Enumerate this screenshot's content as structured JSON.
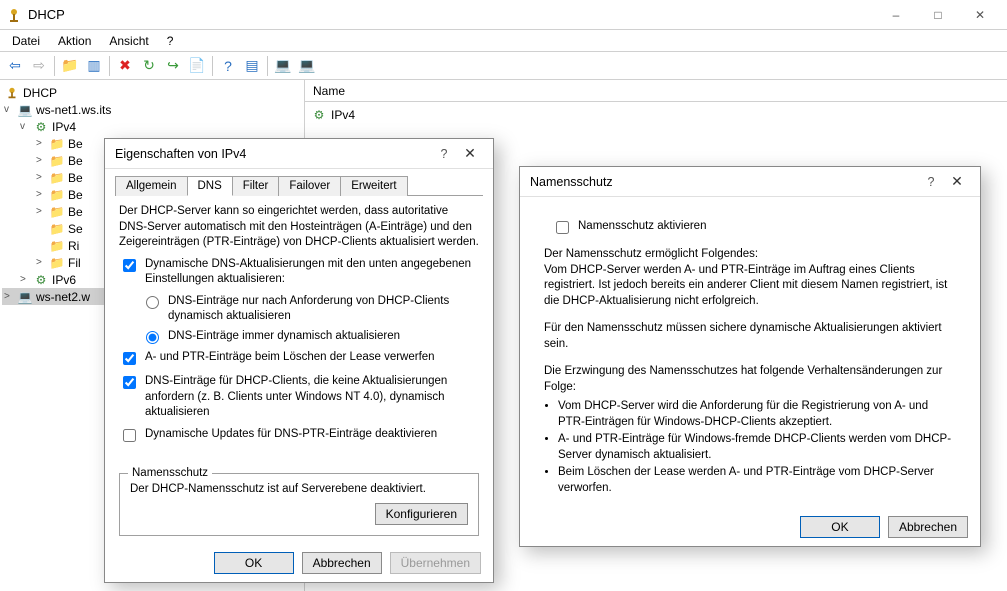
{
  "window": {
    "title": "DHCP"
  },
  "menu": {
    "file": "Datei",
    "action": "Aktion",
    "view": "Ansicht",
    "help": "?"
  },
  "toolbar_icons": [
    "arrow-left",
    "arrow-right",
    "parent-folder",
    "new-window",
    "delete",
    "refresh",
    "export",
    "stop",
    "help",
    "properties",
    "monitor-green",
    "monitor-yellow"
  ],
  "tree": {
    "root": "DHCP",
    "server1": "ws-net1.ws.its",
    "ipv4": "IPv4",
    "folders": [
      "Be",
      "Be",
      "Be",
      "Be",
      "Be",
      "Se",
      "Ri",
      "Fil"
    ],
    "ipv6": "IPv6",
    "server2": "ws-net2.w"
  },
  "list": {
    "header": "Name",
    "items": [
      "IPv4"
    ]
  },
  "dlg1": {
    "title": "Eigenschaften von IPv4",
    "tabs": [
      "Allgemein",
      "DNS",
      "Filter",
      "Failover",
      "Erweitert"
    ],
    "active_tab": 1,
    "intro": "Der DHCP-Server kann so eingerichtet werden, dass autoritative DNS-Server automatisch mit den Hosteinträgen (A-Einträge) und den Zeigereinträgen (PTR-Einträge) von DHCP-Clients aktualisiert werden.",
    "chk_dyn": "Dynamische DNS-Aktualisierungen mit den unten angegebenen Einstellungen aktualisieren:",
    "radio_req": "DNS-Einträge nur nach Anforderung von DHCP-Clients dynamisch aktualisieren",
    "radio_always": "DNS-Einträge immer dynamisch aktualisieren",
    "chk_discard": "A- und PTR-Einträge beim Löschen der Lease verwerfen",
    "chk_noupdate": "DNS-Einträge für DHCP-Clients, die keine Aktualisierungen anfordern (z. B. Clients unter Windows NT 4.0), dynamisch aktualisieren",
    "chk_disable_ptr": "Dynamische Updates für DNS-PTR-Einträge deaktivieren",
    "fieldset_legend": "Namensschutz",
    "fieldset_text": "Der DHCP-Namensschutz ist auf Serverebene deaktiviert.",
    "btn_config": "Konfigurieren",
    "btn_ok": "OK",
    "btn_cancel": "Abbrechen",
    "btn_apply": "Übernehmen"
  },
  "dlg2": {
    "title": "Namensschutz",
    "chk_enable": "Namensschutz aktivieren",
    "p1": "Der Namensschutz ermöglicht Folgendes:",
    "p2": "Vom DHCP-Server werden A- und PTR-Einträge im Auftrag eines Clients registriert. Ist jedoch bereits ein anderer Client mit diesem Namen registriert, ist die DHCP-Aktualisierung nicht erfolgreich.",
    "p3": "Für den Namensschutz müssen sichere dynamische Aktualisierungen aktiviert sein.",
    "p4": "Die Erzwingung des Namensschutzes hat folgende Verhaltensänderungen zur Folge:",
    "b1": "Vom DHCP-Server wird die Anforderung für die Registrierung von A- und PTR-Einträgen für Windows-DHCP-Clients akzeptiert.",
    "b2": "A- und PTR-Einträge für Windows-fremde DHCP-Clients werden vom DHCP-Server dynamisch aktualisiert.",
    "b3": "Beim Löschen der Lease werden A- und PTR-Einträge vom DHCP-Server verworfen.",
    "btn_ok": "OK",
    "btn_cancel": "Abbrechen"
  }
}
